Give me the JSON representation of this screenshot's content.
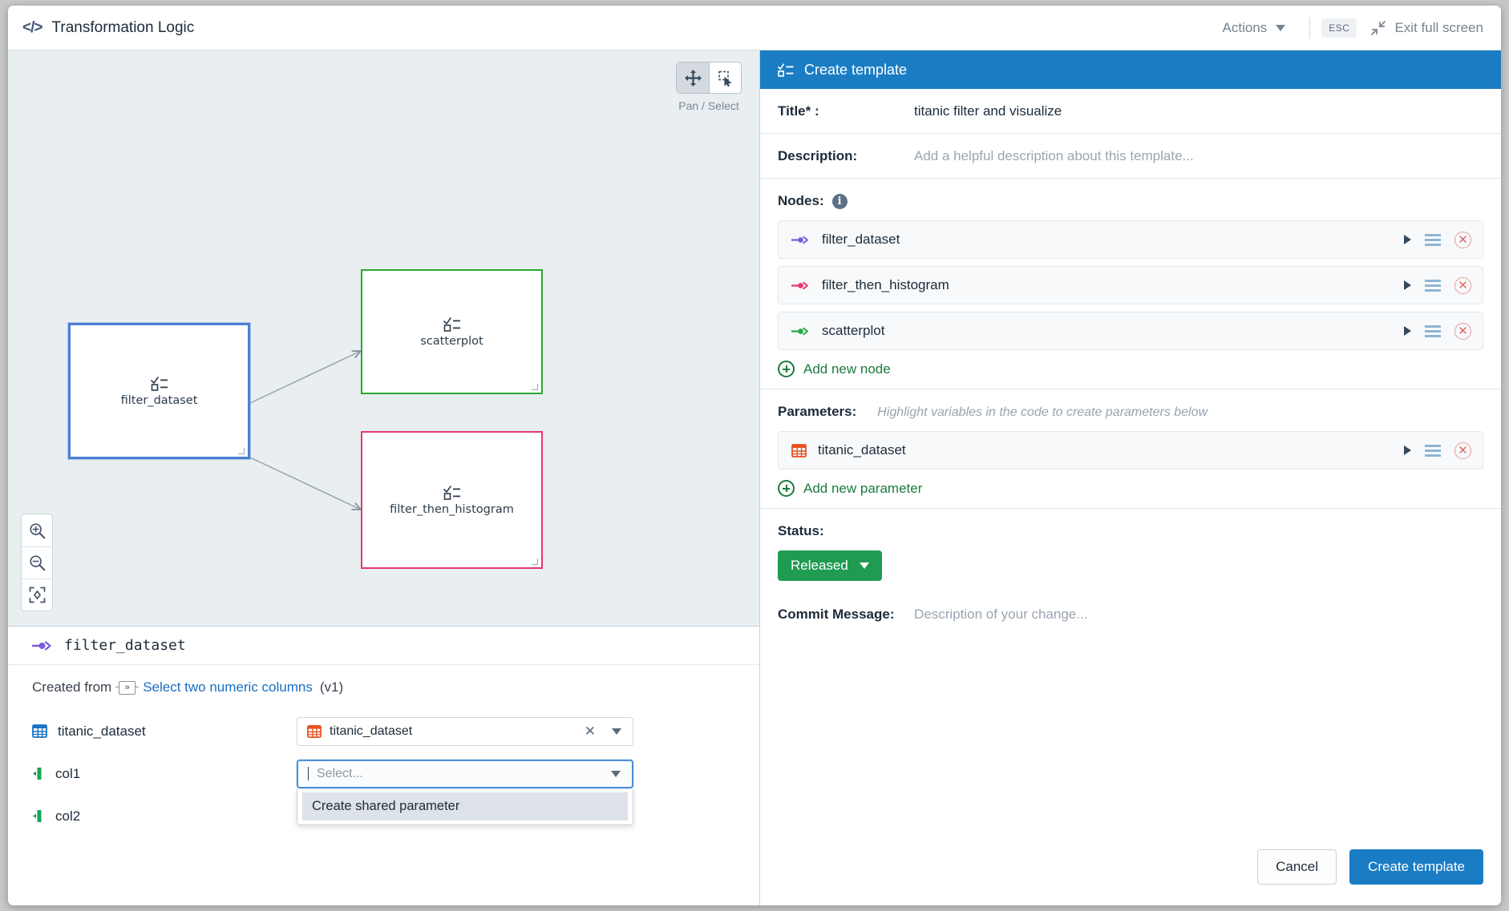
{
  "topbar": {
    "icon": "code-icon",
    "title": "Transformation Logic",
    "actions_label": "Actions",
    "esc_label": "ESC",
    "exit_fullscreen_label": "Exit full screen"
  },
  "canvas": {
    "pan_select_label": "Pan / Select",
    "pan_icon": "move-arrows-icon",
    "select_icon": "marquee-cursor-icon",
    "active_tool": "pan",
    "zoom_in_icon": "zoom-in-icon",
    "zoom_out_icon": "zoom-out-icon",
    "fit_screen_icon": "fit-to-screen-icon",
    "nodes": [
      {
        "label": "filter_dataset",
        "color": "#4a7fd4",
        "state": "selected"
      },
      {
        "label": "scatterplot",
        "color": "#2aa832",
        "state": "green"
      },
      {
        "label": "filter_then_histogram",
        "color": "#e8376f",
        "state": "pink"
      }
    ]
  },
  "node_panel": {
    "title": "filter_dataset",
    "title_icon": "arrow-node-purple-icon",
    "created_from_prefix": "Created from",
    "created_from_icon": "template-icon",
    "created_from_link": "Select two numeric columns",
    "created_from_version": "(v1)",
    "fields": [
      {
        "label": "titanic_dataset",
        "label_icon": "table-blue-icon",
        "value": "titanic_dataset",
        "value_icon": "table-orange-icon",
        "placeholder": "",
        "has_clear": true,
        "focused": false
      },
      {
        "label": "col1",
        "label_icon": "column-green-icon",
        "value": "",
        "value_icon": "",
        "placeholder": "Select...",
        "has_clear": false,
        "focused": true
      },
      {
        "label": "col2",
        "label_icon": "column-green-icon",
        "value": "",
        "value_icon": "",
        "placeholder": "",
        "has_clear": false,
        "focused": false
      }
    ],
    "dropdown_options": [
      "Create shared parameter"
    ]
  },
  "right_panel": {
    "header_title": "Create template",
    "header_icon": "template-list-icon",
    "title_label": "Title* :",
    "title_value": "titanic filter and visualize",
    "description_label": "Description:",
    "description_placeholder": "Add a helpful description about this template...",
    "nodes_label": "Nodes:",
    "nodes_info_icon": "info-icon",
    "nodes": [
      {
        "name": "filter_dataset",
        "icon": "arrow-node-icon",
        "color": "#7c5cd6"
      },
      {
        "name": "filter_then_histogram",
        "icon": "arrow-node-icon",
        "color": "#e8376f"
      },
      {
        "name": "scatterplot",
        "icon": "arrow-node-icon",
        "color": "#29a745"
      }
    ],
    "add_node_label": "Add new node",
    "parameters_label": "Parameters:",
    "parameters_hint": "Highlight variables in the code to create parameters below",
    "parameters": [
      {
        "name": "titanic_dataset",
        "icon": "table-orange-icon",
        "color": "#e8511f"
      }
    ],
    "add_parameter_label": "Add new parameter",
    "status_label": "Status:",
    "status_value": "Released",
    "status_color": "#1f9c52",
    "commit_label": "Commit Message:",
    "commit_placeholder": "Description of your change...",
    "cancel_label": "Cancel",
    "create_label": "Create template",
    "row_icons": {
      "expand": "triangle-right-icon",
      "menu": "hamburger-icon",
      "delete": "delete-circle-x-icon"
    }
  }
}
